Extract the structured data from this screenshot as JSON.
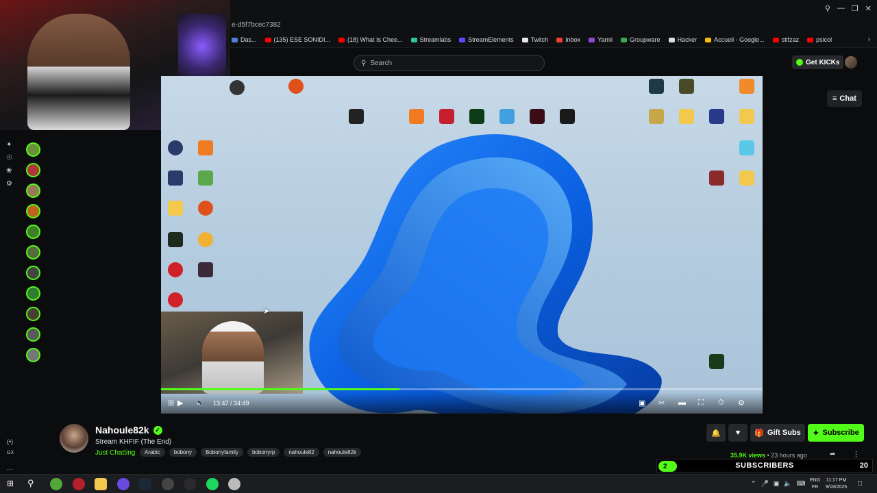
{
  "browser": {
    "url_fragment": "e-d5f7bcec7382",
    "bookmarks": [
      {
        "label": "Das...",
        "color": "#4f7fd6"
      },
      {
        "label": "(135) ESE SONIDI...",
        "color": "#ff0000"
      },
      {
        "label": "(18) What Is Chee...",
        "color": "#ff0000"
      },
      {
        "label": "Streamlabs",
        "color": "#31c3a2"
      },
      {
        "label": "StreamElements",
        "color": "#5a4bff"
      },
      {
        "label": "Twitch",
        "color": "#e8e8e8"
      },
      {
        "label": "Inbox",
        "color": "#ea4335"
      },
      {
        "label": "Yamli",
        "color": "#8a49d8"
      },
      {
        "label": "Groupware",
        "color": "#2fae5a"
      },
      {
        "label": "Hacker",
        "color": "#dddddd"
      },
      {
        "label": "Accueil - Google...",
        "color": "#fbbc05"
      },
      {
        "label": "stifzaz",
        "color": "#ff0000"
      },
      {
        "label": "psicol",
        "color": "#ff0000"
      }
    ]
  },
  "header": {
    "search_placeholder": "Search",
    "get_kicks_label": "Get KICKs"
  },
  "chat_toggle": {
    "label": "Chat"
  },
  "player": {
    "current_time": "13:47",
    "duration": "34:49",
    "progress": 0.396
  },
  "channel": {
    "name": "Nahoule82k",
    "title": "Stream KHFIF (The End)",
    "category": "Just Chatting",
    "tags": [
      "Arabic",
      "bobony",
      "Bobonyfamily",
      "bobonyrp",
      "nahoule82",
      "nahoule82k"
    ],
    "views": "35.9K views",
    "time_ago": "23 hours ago",
    "gift_subs_label": "Gift Subs",
    "subscribe_label": "Subscribe"
  },
  "sub_goal": {
    "label": "SUBSCRIBERS",
    "current": "2",
    "target": "20"
  },
  "sidebar": {
    "avatar_colors": [
      "#6b8f3a",
      "#b3333a",
      "#9a7a55",
      "#c0621e",
      "#3f7f2a",
      "#566b3b",
      "#444",
      "#2e7d32",
      "#4a3f35",
      "#5a5a5a",
      "#777"
    ],
    "extra_label": "GX"
  },
  "taskbar": {
    "language": "ENG",
    "region": "FR",
    "time": "11:17 PM",
    "date": "9/18/2025"
  },
  "colors": {
    "accent": "#53fc18"
  }
}
